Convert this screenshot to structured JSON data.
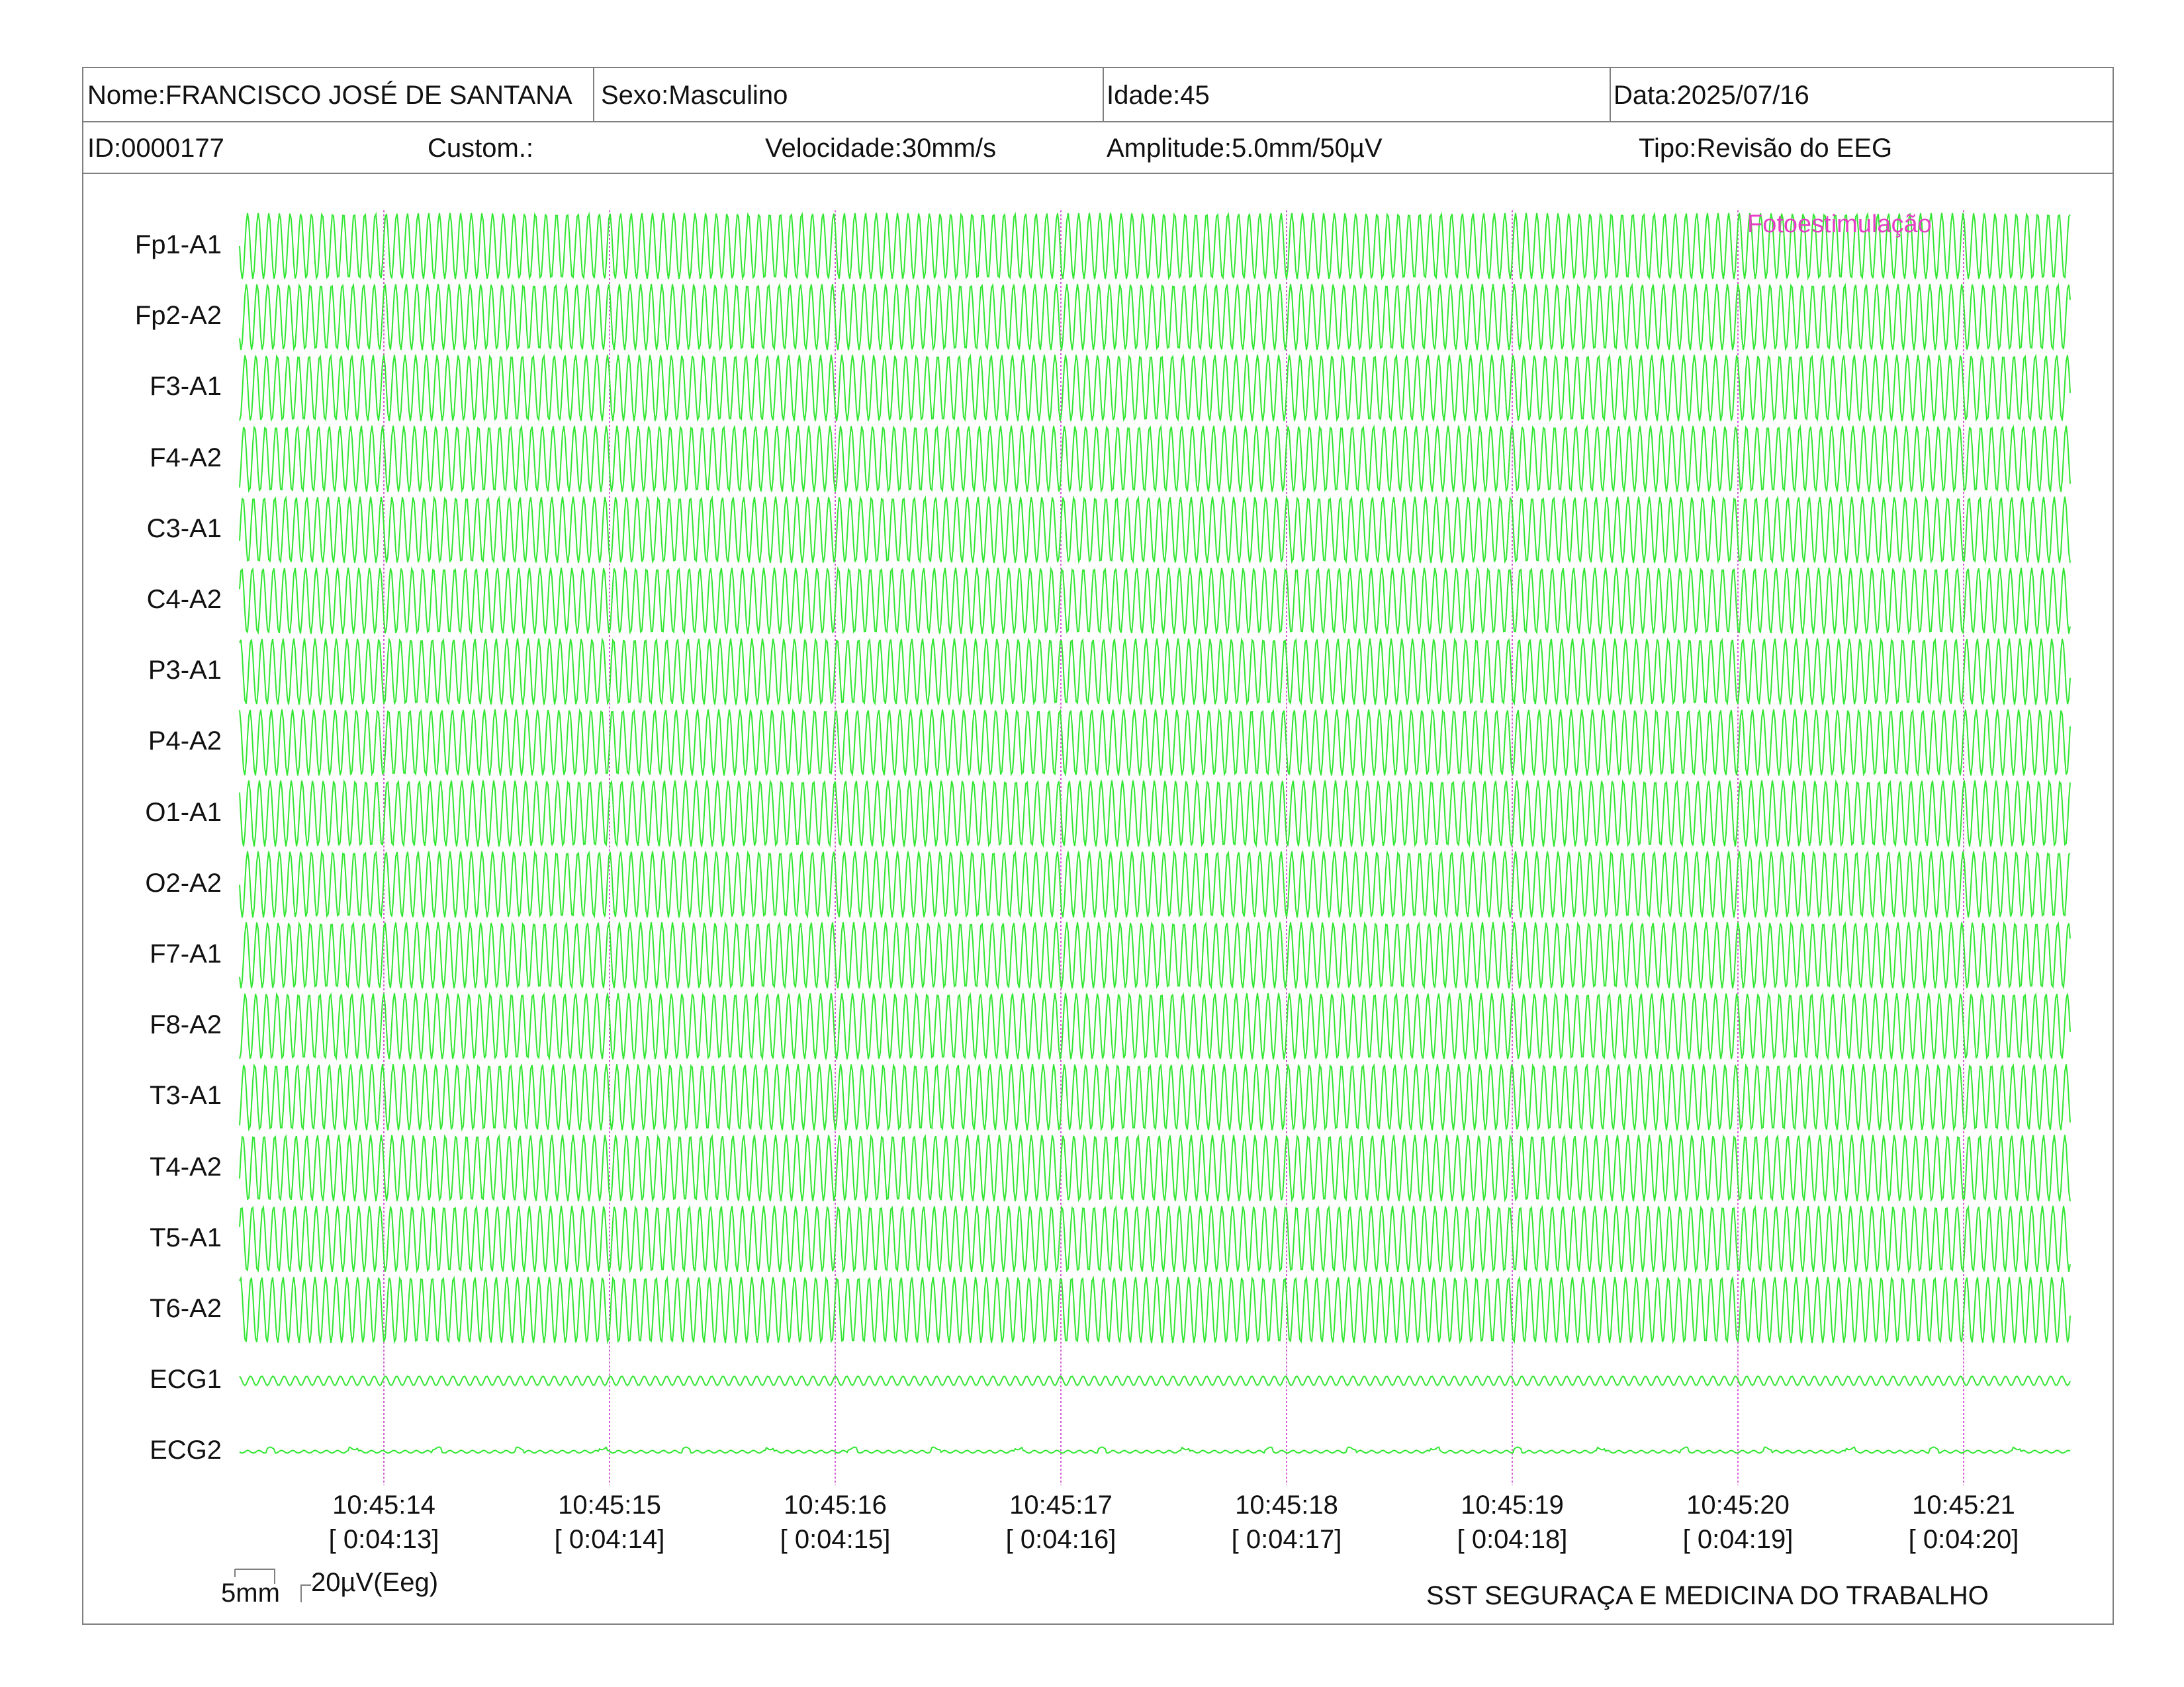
{
  "header": {
    "name": "Nome:FRANCISCO JOSÉ DE SANTANA",
    "sex": "Sexo:Masculino",
    "age": "Idade:45",
    "date": "Data:2025/07/16",
    "id": "ID:0000177",
    "custom": "Custom.:",
    "speed": "Velocidade:30mm/s",
    "amplitude": "Amplitude:5.0mm/50µV",
    "type": "Tipo:Revisão do EEG"
  },
  "channels": [
    "Fp1-A1",
    "Fp2-A2",
    "F3-A1",
    "F4-A2",
    "C3-A1",
    "C4-A2",
    "P3-A1",
    "P4-A2",
    "O1-A1",
    "O2-A2",
    "F7-A1",
    "F8-A2",
    "T3-A1",
    "T4-A2",
    "T5-A1",
    "T6-A2",
    "ECG1",
    "ECG2"
  ],
  "event": {
    "label": "Fotoestimulação",
    "color": "#e43fc4"
  },
  "time_marks": [
    {
      "clock": "10:45:14",
      "elapsed": "[ 0:04:13]"
    },
    {
      "clock": "10:45:15",
      "elapsed": "[ 0:04:14]"
    },
    {
      "clock": "10:45:16",
      "elapsed": "[ 0:04:15]"
    },
    {
      "clock": "10:45:17",
      "elapsed": "[ 0:04:16]"
    },
    {
      "clock": "10:45:18",
      "elapsed": "[ 0:04:17]"
    },
    {
      "clock": "10:45:19",
      "elapsed": "[ 0:04:18]"
    },
    {
      "clock": "10:45:20",
      "elapsed": "[ 0:04:19]"
    },
    {
      "clock": "10:45:21",
      "elapsed": "[ 0:04:20]"
    }
  ],
  "calibration": {
    "time_label": "5mm",
    "amp_label": "20µV(Eeg)"
  },
  "footer": {
    "company": "SST SEGURAÇA E MEDICINA DO TRABALHO"
  },
  "colors": {
    "trace": "#33e633",
    "marker": "#d25fd2",
    "border": "#7f7f7f"
  }
}
